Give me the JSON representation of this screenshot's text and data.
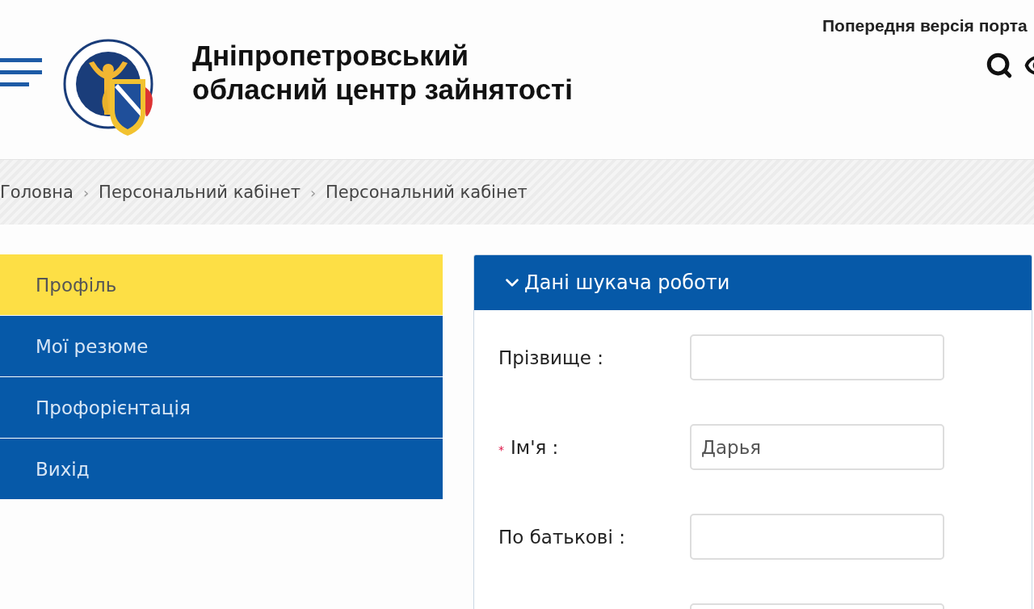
{
  "header": {
    "title_lines": [
      "Дніпропетровський",
      "обласний центр зайнятості"
    ],
    "top_link": "Попередня версія порта"
  },
  "breadcrumbs": [
    "Головна",
    "Персональний кабінет",
    "Персональний кабінет"
  ],
  "breadcrumb_separator": "›",
  "sidebar": {
    "items": [
      {
        "label": "Профіль",
        "selected": true
      },
      {
        "label": "Мої резюме",
        "selected": false
      },
      {
        "label": "Профорієнтація",
        "selected": false
      },
      {
        "label": "Вихід",
        "selected": false
      }
    ]
  },
  "panel": {
    "title": "Дані шукача роботи",
    "expanded": true,
    "required_mark": "*",
    "fields": [
      {
        "kind": "labeled",
        "label": "Прізвище :",
        "required": false
      },
      {
        "kind": "labeled",
        "label": "Ім'я :",
        "required": true,
        "value": "Дарья"
      },
      {
        "kind": "labeled",
        "label": "По батькові :",
        "required": false
      },
      {
        "kind": "bare"
      }
    ]
  }
}
